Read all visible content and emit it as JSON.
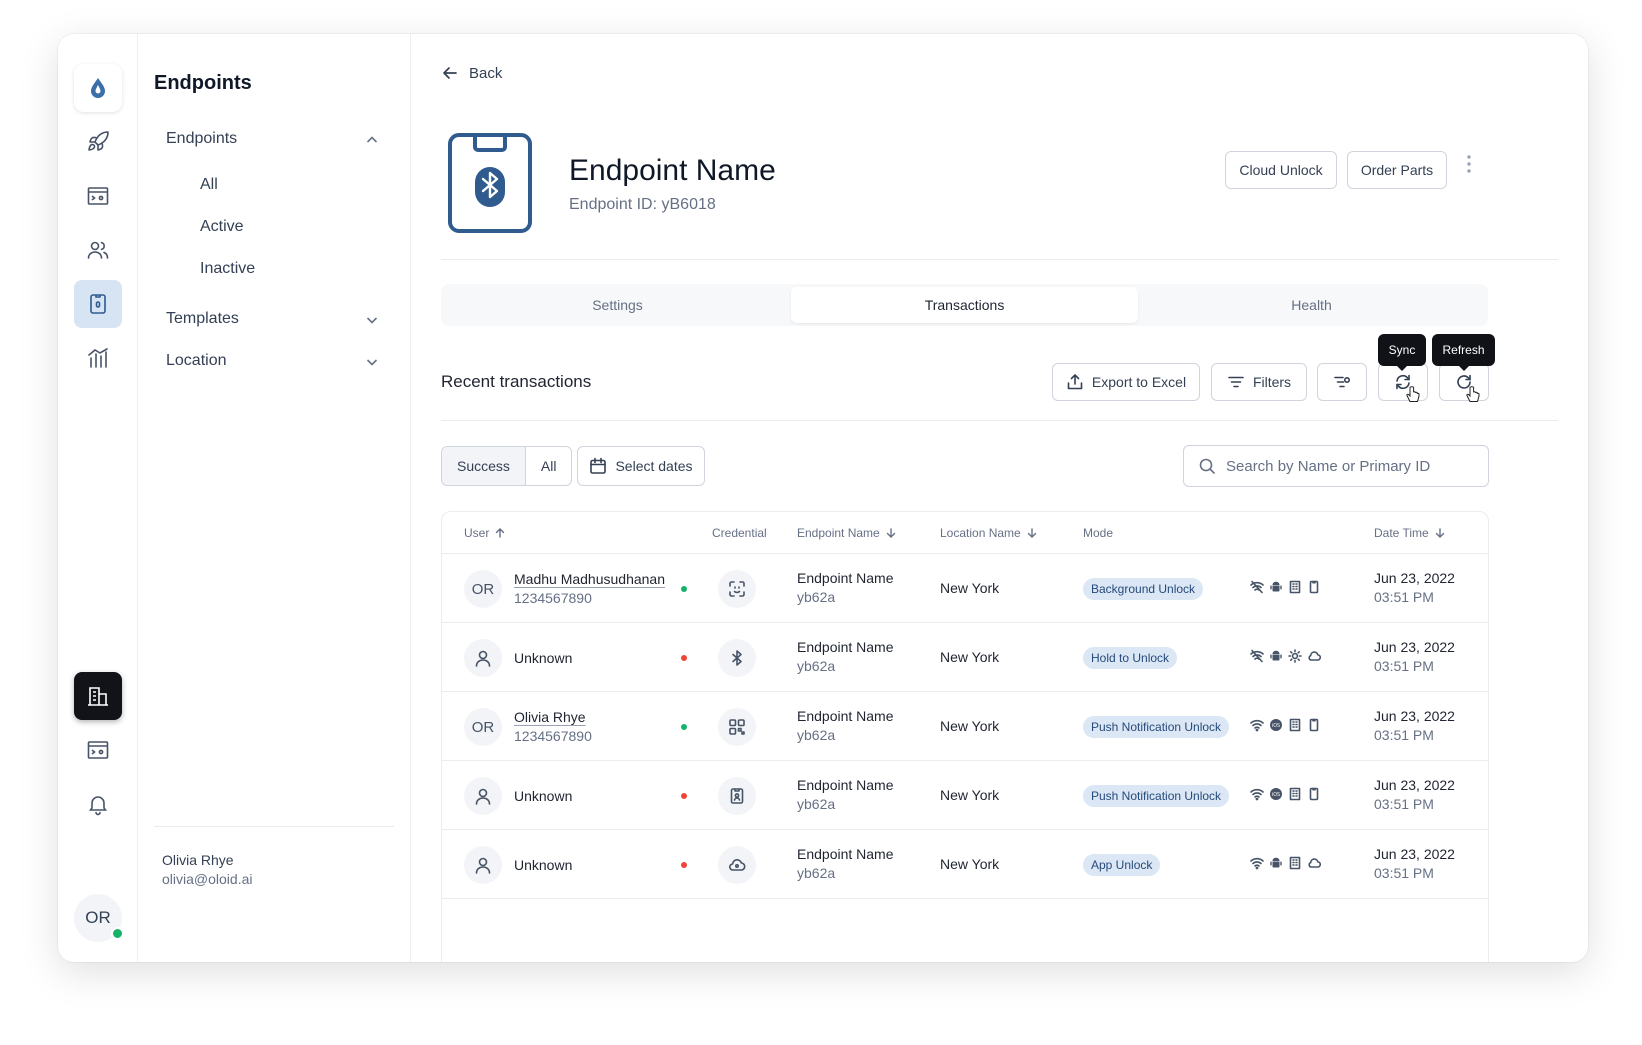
{
  "rail": {
    "avatar_initials": "OR"
  },
  "sidebar": {
    "title": "Endpoints",
    "groups": [
      {
        "label": "Endpoints",
        "expanded": true,
        "items": [
          "All",
          "Active",
          "Inactive"
        ]
      },
      {
        "label": "Templates",
        "expanded": false
      },
      {
        "label": "Location",
        "expanded": false
      }
    ],
    "user": {
      "name": "Olivia Rhye",
      "email": "olivia@oloid.ai"
    }
  },
  "header": {
    "back_label": "Back",
    "title": "Endpoint Name",
    "endpoint_id": "Endpoint ID: yB6018",
    "cloud_unlock_label": "Cloud Unlock",
    "order_parts_label": "Order Parts"
  },
  "tabs": [
    {
      "label": "Settings",
      "active": false
    },
    {
      "label": "Transactions",
      "active": true
    },
    {
      "label": "Health",
      "active": false
    }
  ],
  "transactions": {
    "title": "Recent transactions",
    "export_label": "Export to Excel",
    "filters_label": "Filters",
    "sync_tooltip": "Sync",
    "refresh_tooltip": "Refresh",
    "segment": [
      "Success",
      "All"
    ],
    "select_dates_label": "Select dates",
    "search_placeholder": "Search by Name or Primary ID"
  },
  "table": {
    "columns": {
      "user": "User",
      "credential": "Credential",
      "endpoint_name": "Endpoint Name",
      "location_name": "Location Name",
      "mode": "Mode",
      "date_time": "Date Time"
    },
    "rows": [
      {
        "initials": "OR",
        "name": "Madhu Madhusudhanan",
        "id": "1234567890",
        "status": "success",
        "credential_icon": "face-scan-icon",
        "endpoint": "Endpoint Name",
        "endpoint_id": "yb62a",
        "location": "New York",
        "mode": "Background Unlock",
        "caps": [
          "wifi-off-icon",
          "android-icon",
          "building-icon",
          "phone-icon"
        ],
        "date": "Jun 23, 2022",
        "time": "03:51 PM"
      },
      {
        "initials": "",
        "name": "Unknown",
        "id": "",
        "status": "failed",
        "credential_icon": "bluetooth-icon",
        "endpoint": "Endpoint Name",
        "endpoint_id": "yb62a",
        "location": "New York",
        "mode": "Hold to Unlock",
        "caps": [
          "wifi-off-icon",
          "android-icon",
          "sun-icon",
          "cloud-icon"
        ],
        "date": "Jun 23, 2022",
        "time": "03:51 PM"
      },
      {
        "initials": "OR",
        "name": "Olivia Rhye",
        "id": "1234567890",
        "status": "success",
        "credential_icon": "qr-code-icon",
        "endpoint": "Endpoint Name",
        "endpoint_id": "yb62a",
        "location": "New York",
        "mode": "Push Notification Unlock",
        "caps": [
          "wifi-icon",
          "ios-icon",
          "building-icon",
          "phone-icon"
        ],
        "date": "Jun 23, 2022",
        "time": "03:51 PM"
      },
      {
        "initials": "",
        "name": "Unknown",
        "id": "",
        "status": "failed",
        "credential_icon": "badge-icon",
        "endpoint": "Endpoint Name",
        "endpoint_id": "yb62a",
        "location": "New York",
        "mode": "Push Notification Unlock",
        "caps": [
          "wifi-icon",
          "ios-icon",
          "building-icon",
          "phone-icon"
        ],
        "date": "Jun 23, 2022",
        "time": "03:51 PM"
      },
      {
        "initials": "",
        "name": "Unknown",
        "id": "",
        "status": "failed",
        "credential_icon": "cloud-key-icon",
        "endpoint": "Endpoint Name",
        "endpoint_id": "yb62a",
        "location": "New York",
        "mode": "App Unlock",
        "caps": [
          "wifi-icon",
          "android-icon",
          "building-icon",
          "cloud-icon"
        ],
        "date": "Jun 23, 2022",
        "time": "03:51 PM"
      }
    ]
  },
  "colors": {
    "accent": "#2f5b8f",
    "success": "#17b26a",
    "failed": "#f04438",
    "mode_badge_bg": "#dbe7f5"
  }
}
